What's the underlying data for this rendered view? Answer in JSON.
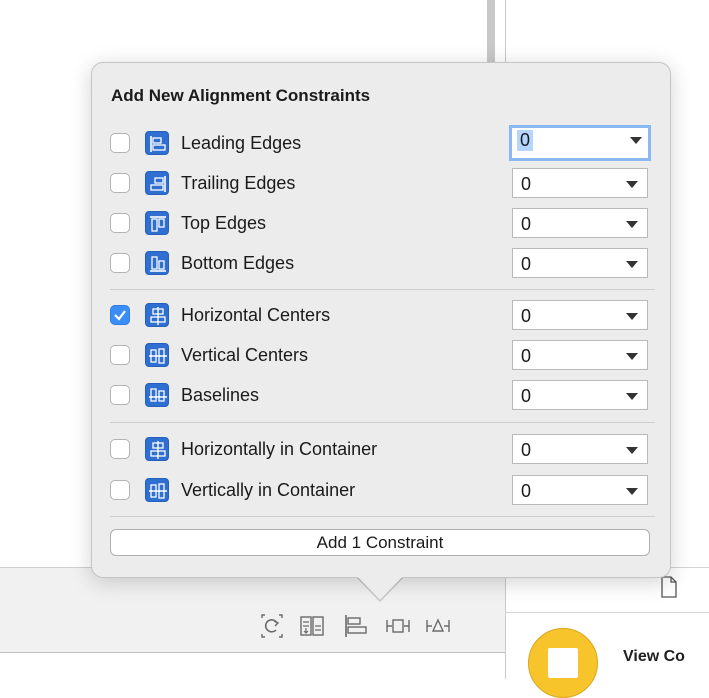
{
  "popover": {
    "title": "Add New Alignment Constraints",
    "groups": [
      [
        {
          "label": "Leading Edges",
          "checked": false,
          "value": "0",
          "focused": true,
          "icon": "leading-edges-icon"
        },
        {
          "label": "Trailing Edges",
          "checked": false,
          "value": "0",
          "icon": "trailing-edges-icon"
        },
        {
          "label": "Top Edges",
          "checked": false,
          "value": "0",
          "icon": "top-edges-icon"
        },
        {
          "label": "Bottom Edges",
          "checked": false,
          "value": "0",
          "icon": "bottom-edges-icon"
        }
      ],
      [
        {
          "label": "Horizontal Centers",
          "checked": true,
          "value": "0",
          "icon": "horizontal-centers-icon"
        },
        {
          "label": "Vertical Centers",
          "checked": false,
          "value": "0",
          "icon": "vertical-centers-icon"
        },
        {
          "label": "Baselines",
          "checked": false,
          "value": "0",
          "icon": "baselines-icon"
        }
      ],
      [
        {
          "label": "Horizontally in Container",
          "checked": false,
          "value": "0",
          "icon": "horizontally-in-container-icon"
        },
        {
          "label": "Vertically in Container",
          "checked": false,
          "value": "0",
          "icon": "vertically-in-container-icon"
        }
      ]
    ],
    "add_button_label": "Add 1 Constraint"
  },
  "colors": {
    "accent": "#3a8ef6",
    "icon_blue": "#2f6fd1",
    "focus_ring": "#8ab8f3",
    "view_controller_yellow": "#f7c42b"
  },
  "toolbar_icons": [
    "update-frames-icon",
    "embed-in-stack-icon",
    "align-icon",
    "pin-icon",
    "resolve-issues-icon"
  ],
  "inspector": {
    "object_label": "View Co",
    "document_icon": "document-icon"
  }
}
